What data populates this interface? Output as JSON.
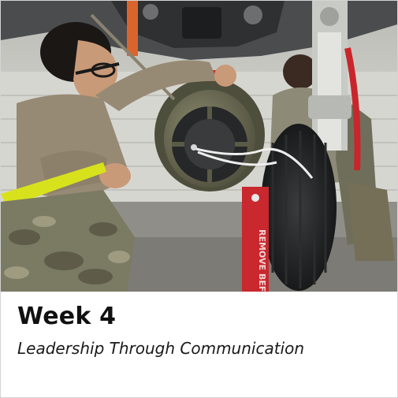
{
  "card": {
    "title": "Week 4",
    "subtitle": "Leadership Through Communication"
  },
  "photo": {
    "tag_text": "REMOVE BEFORE FLIGHT"
  },
  "colors": {
    "caption_background": "#ffffff",
    "title_text": "#111111",
    "subtitle_text": "#1a1a1a",
    "card_border": "#d4d4d4"
  }
}
